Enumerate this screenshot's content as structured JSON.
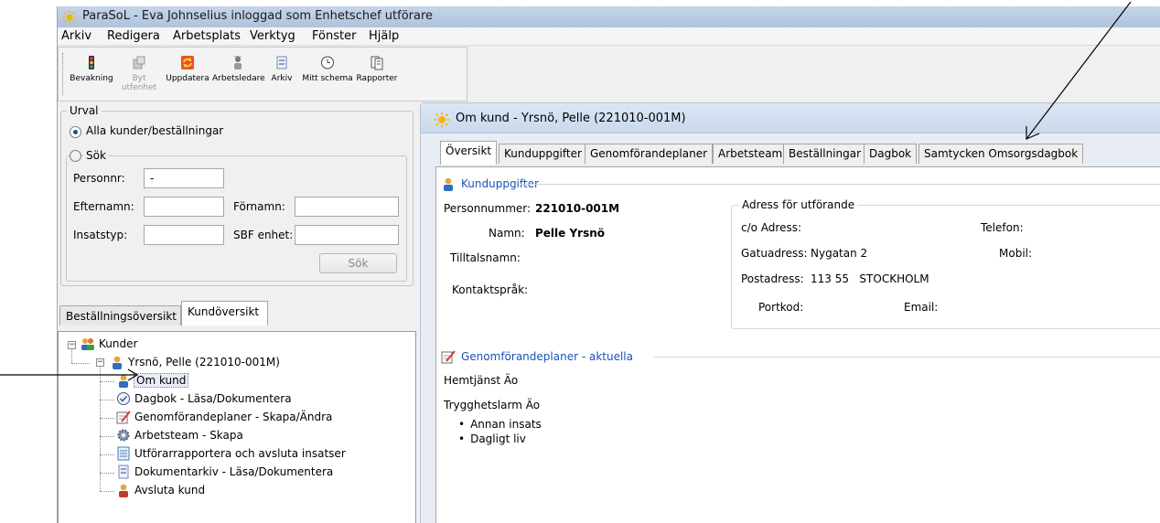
{
  "window": {
    "title": "ParaSoL - Eva Johnselius inloggad som Enhetschef utförare"
  },
  "menu": [
    "Arkiv",
    "Redigera",
    "Arbetsplats",
    "Verktyg",
    "Fönster",
    "Hjälp"
  ],
  "toolbar": {
    "buttons": [
      {
        "label": "Bevakning",
        "icon": "traffic-light-icon"
      },
      {
        "label": "Byt utfenhet",
        "icon": "switch-unit-icon",
        "disabled": true
      },
      {
        "label": "Uppdatera",
        "icon": "refresh-icon"
      },
      {
        "label": "Arbetsledare",
        "icon": "arbetsledare-icon"
      },
      {
        "label": "Arkiv",
        "icon": "archive-icon"
      },
      {
        "label": "Mitt schema",
        "icon": "clock-icon"
      },
      {
        "label": "Rapporter",
        "icon": "report-icon"
      }
    ]
  },
  "urval": {
    "legend": "Urval",
    "option_all": "Alla kunder/beställningar",
    "option_search": "Sök",
    "personnr_label": "Personnr:",
    "personnr_value": "-",
    "efternamn_label": "Efternamn:",
    "fornamn_label": "Förnamn:",
    "insatstyp_label": "Insatstyp:",
    "sbf_label": "SBF enhet:",
    "search_button": "Sök"
  },
  "left_tabs": [
    "Beställningsöversikt",
    "Kundöversikt"
  ],
  "tree": {
    "root": "Kunder",
    "customer": "Yrsnö, Pelle (221010-001M)",
    "items": [
      "Om kund",
      "Dagbok - Läsa/Dokumentera",
      "Genomförandeplaner - Skapa/Ändra",
      "Arbetsteam - Skapa",
      "Utförarrapportera och avsluta insatser",
      "Dokumentarkiv - Läsa/Dokumentera",
      "Avsluta kund"
    ]
  },
  "inner": {
    "title": "Om kund - Yrsnö, Pelle (221010-001M)",
    "tabs": [
      "Översikt",
      "Kunduppgifter",
      "Genomförandeplaner",
      "Arbetsteam",
      "Beställningar",
      "Dagbok",
      "Samtycken Omsorgsdagbok"
    ]
  },
  "kunduppgifter": {
    "header": "Kunduppgifter",
    "personnummer_label": "Personnummer:",
    "personnummer_value": "221010-001M",
    "namn_label": "Namn:",
    "namn_value": "Pelle Yrsnö",
    "tilltalsnamn_label": "Tilltalsnamn:",
    "kontaktsprak_label": "Kontaktspråk:"
  },
  "adress": {
    "legend": "Adress för utförande",
    "co_label": "c/o Adress:",
    "gatu_label": "Gatuadress:",
    "gatu_value": "Nygatan 2",
    "post_label": "Postadress:",
    "post_value": "113 55   STOCKHOLM",
    "portkod_label": "Portkod:",
    "telefon_label": "Telefon:",
    "mobil_label": "Mobil:",
    "email_label": "Email:"
  },
  "plans": {
    "header": "Genomförandeplaner - aktuella",
    "items": [
      "Hemtjänst Äo",
      "Trygghetslarm Äo"
    ],
    "bullets": [
      "Annan insats",
      "Dagligt liv"
    ]
  },
  "colors": {
    "link_blue": "#1b52b8",
    "title_bar": "#b9cce3"
  }
}
